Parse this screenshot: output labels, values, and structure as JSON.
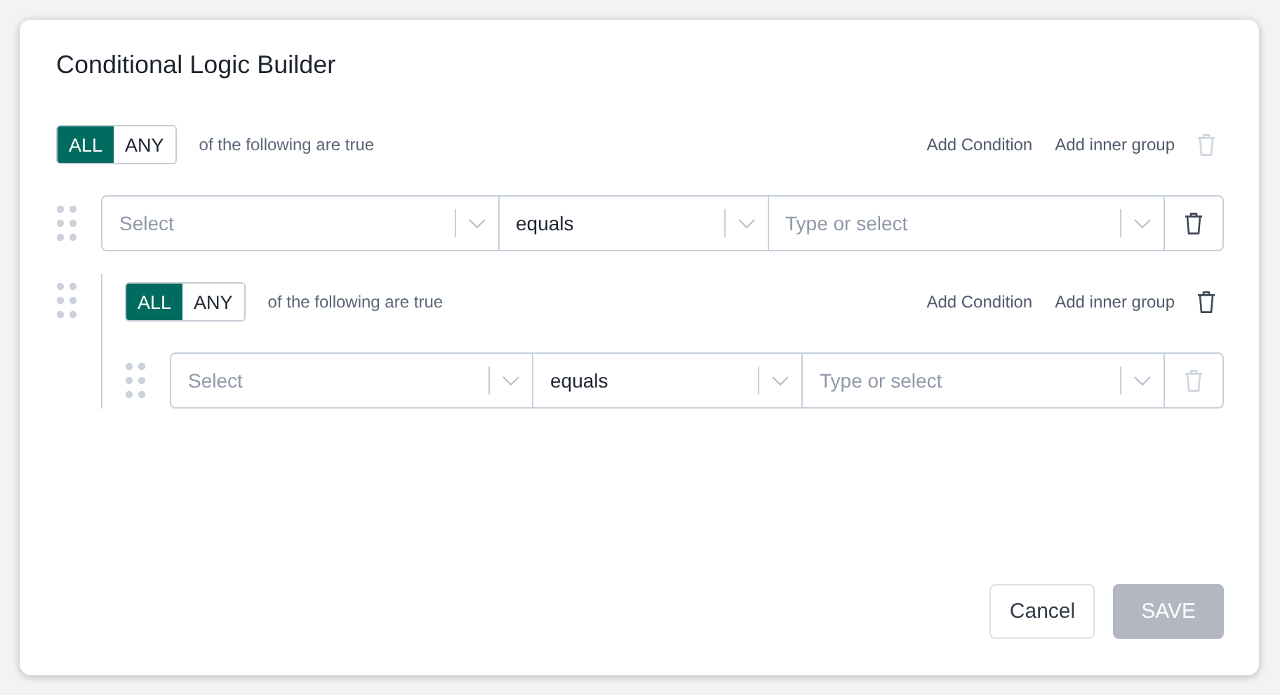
{
  "dialog": {
    "title": "Conditional Logic Builder",
    "root": {
      "modes": [
        {
          "label": "ALL",
          "selected": true
        },
        {
          "label": "ANY",
          "selected": false
        }
      ],
      "caption": "of the following are true",
      "actions": [
        "Add Condition",
        "Add inner group"
      ],
      "delete_disabled": true,
      "items": [
        {
          "kind": "condition",
          "field": {
            "placeholder": "Select"
          },
          "operator": {
            "value": "equals"
          },
          "value": {
            "placeholder": "Type or select"
          },
          "delete_disabled": false
        },
        {
          "kind": "group",
          "modes": [
            {
              "label": "ALL",
              "selected": true
            },
            {
              "label": "ANY",
              "selected": false
            }
          ],
          "caption": "of the following are true",
          "actions": [
            "Add Condition",
            "Add inner group"
          ],
          "delete_disabled": false,
          "items": [
            {
              "kind": "condition",
              "field": {
                "placeholder": "Select"
              },
              "operator": {
                "value": "equals"
              },
              "value": {
                "placeholder": "Type or select"
              },
              "delete_disabled": true
            }
          ]
        }
      ]
    },
    "buttons": [
      {
        "label": "Cancel",
        "kind": "secondary"
      },
      {
        "label": "SAVE",
        "kind": "primary",
        "disabled": true
      }
    ]
  }
}
